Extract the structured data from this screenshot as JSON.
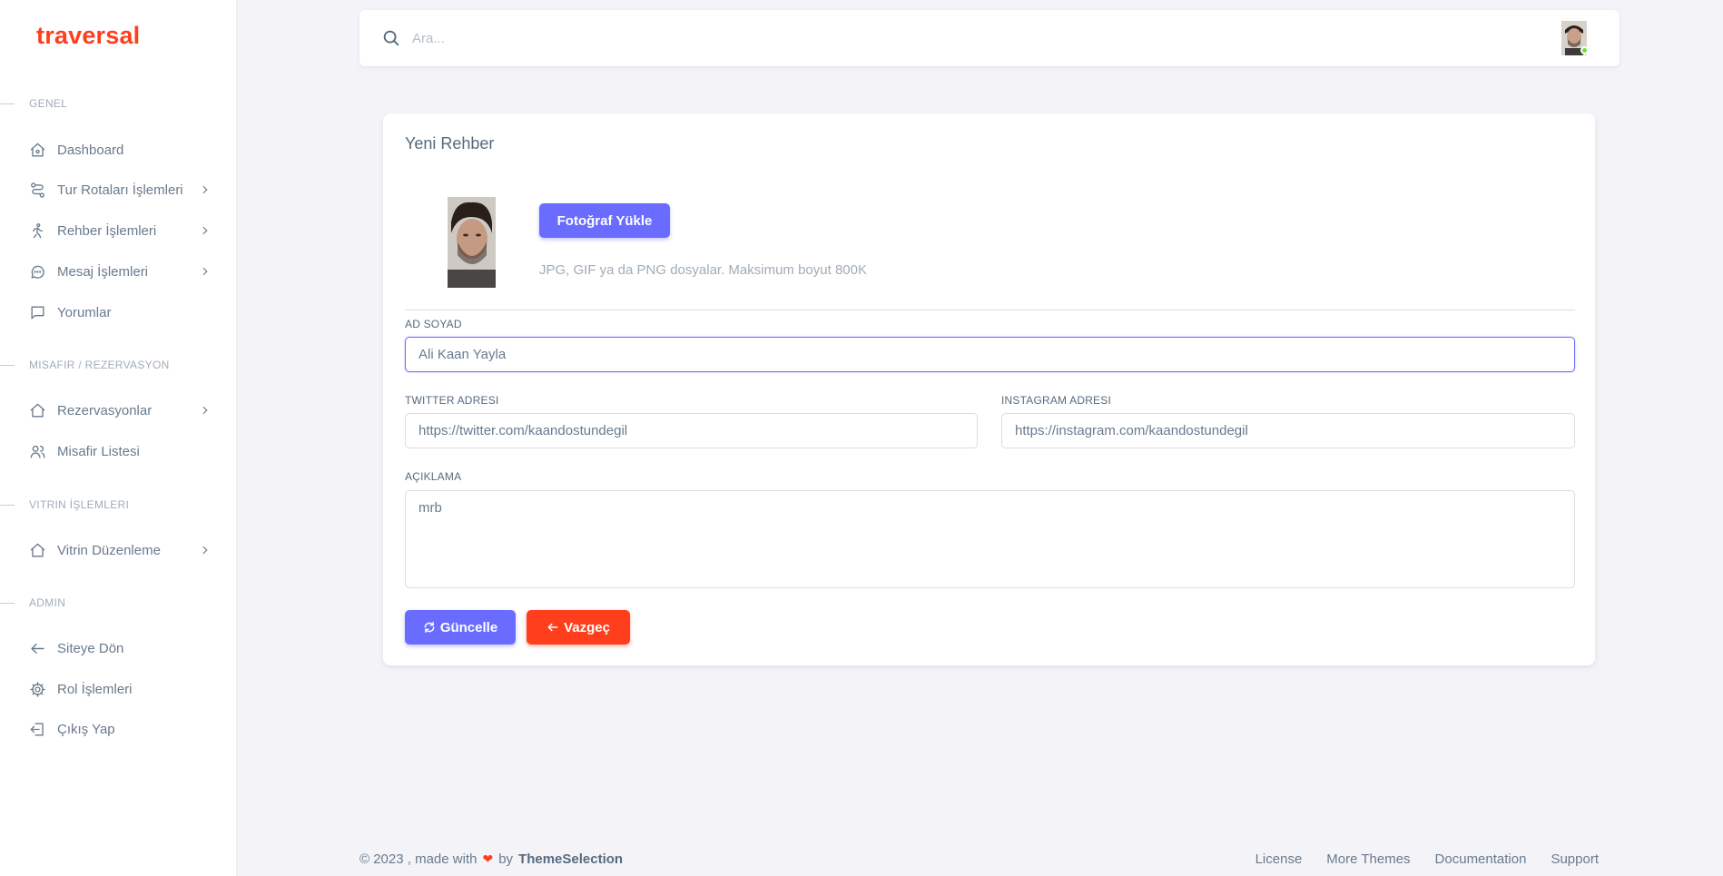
{
  "brand": "traversal",
  "sidebar": {
    "sections": [
      {
        "header": "GENEL",
        "items": [
          {
            "label": "Dashboard",
            "icon": "home-icon",
            "has_submenu": false
          },
          {
            "label": "Tur Rotaları İşlemleri",
            "icon": "route-icon",
            "has_submenu": true
          },
          {
            "label": "Rehber İşlemleri",
            "icon": "walk-icon",
            "has_submenu": true
          },
          {
            "label": "Mesaj İşlemleri",
            "icon": "chat-icon",
            "has_submenu": true
          },
          {
            "label": "Yorumlar",
            "icon": "comment-icon",
            "has_submenu": false
          }
        ]
      },
      {
        "header": "MISAFIR / REZERVASYON",
        "items": [
          {
            "label": "Rezervasyonlar",
            "icon": "home-icon",
            "has_submenu": true
          },
          {
            "label": "Misafir Listesi",
            "icon": "users-icon",
            "has_submenu": false
          }
        ]
      },
      {
        "header": "VITRIN İŞLEMLERI",
        "items": [
          {
            "label": "Vitrin Düzenleme",
            "icon": "home-icon",
            "has_submenu": true
          }
        ]
      },
      {
        "header": "ADMIN",
        "items": [
          {
            "label": "Siteye Dön",
            "icon": "arrow-left-icon",
            "has_submenu": false
          },
          {
            "label": "Rol İşlemleri",
            "icon": "gear-icon",
            "has_submenu": false
          },
          {
            "label": "Çıkış Yap",
            "icon": "logout-icon",
            "has_submenu": false
          }
        ]
      }
    ]
  },
  "navbar": {
    "search_placeholder": "Ara...",
    "status_color": "#71dd37"
  },
  "form": {
    "title": "Yeni Rehber",
    "upload_button": "Fotoğraf Yükle",
    "upload_hint": "JPG, GIF ya da PNG dosyalar. Maksimum boyut 800K",
    "name_label": "AD SOYAD",
    "name_value": "Ali Kaan Yayla",
    "twitter_label": "TWITTER ADRESI",
    "twitter_value": "https://twitter.com/kaandostundegil",
    "instagram_label": "INSTAGRAM ADRESI",
    "instagram_value": "https://instagram.com/kaandostundegil",
    "description_label": "AÇIKLAMA",
    "description_value": "mrb",
    "update_button": "Güncelle",
    "cancel_button": "Vazgeç"
  },
  "footer": {
    "copyright": "© 2023 , made with",
    "by": "by",
    "brand": "ThemeSelection",
    "links": [
      "License",
      "More Themes",
      "Documentation",
      "Support"
    ]
  },
  "colors": {
    "primary": "#696cff",
    "danger": "#ff3e1d",
    "brand": "#ff3e1d"
  }
}
